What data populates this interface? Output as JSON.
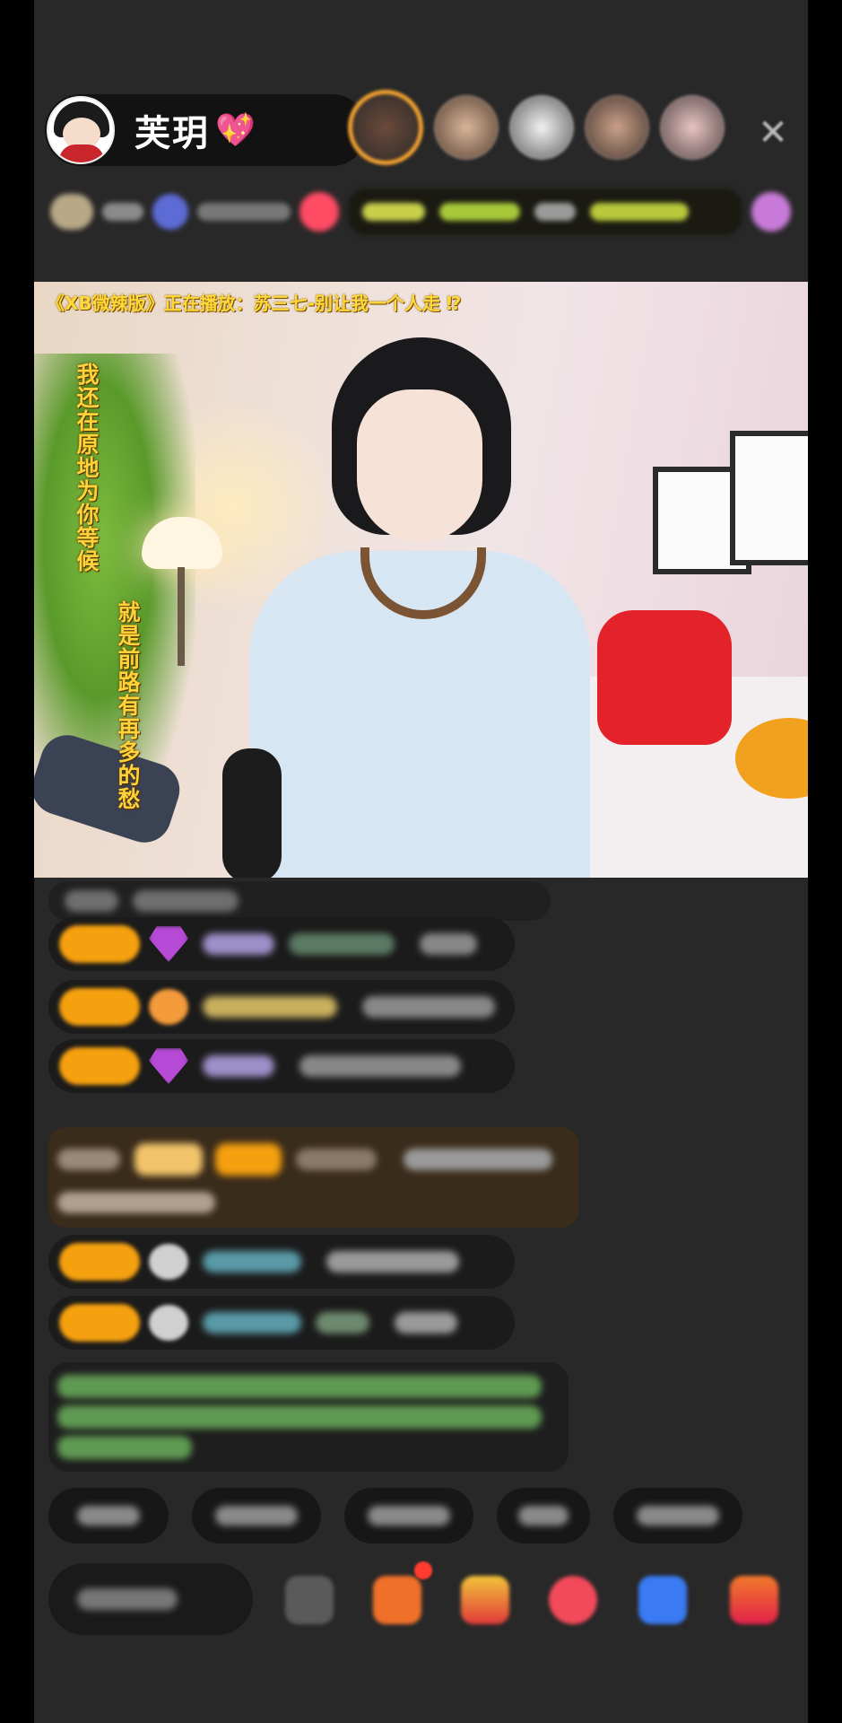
{
  "header": {
    "host_name": "芙玥",
    "heart_glyph": "💖",
    "close_glyph": "✕",
    "viewer_avatar_count": 5,
    "accent_color": "#f0a030"
  },
  "video": {
    "now_playing": "《XB微辣版》正在播放：苏三七-别让我一个人走 ⁉",
    "lyric_line_1": "我还在原地为你等候",
    "lyric_line_2": "就是前路有再多的愁"
  },
  "chat": {
    "level_badge_color": "#f5a00f",
    "gift_bubble_color": "#3a2c1b"
  },
  "toolbar": {
    "quick_reply_count": 5
  }
}
